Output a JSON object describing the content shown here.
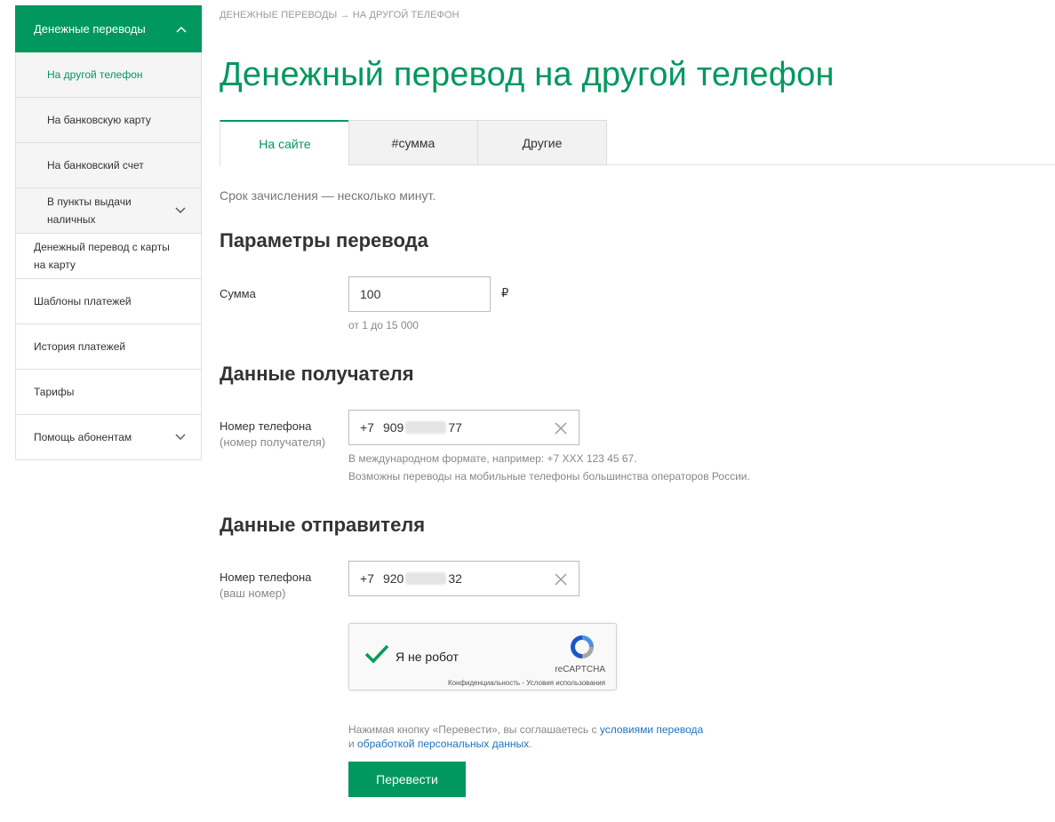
{
  "sidebar": {
    "header": {
      "label": "Денежные переводы",
      "icon": "chevron-up-icon"
    },
    "sub_items": [
      {
        "label": "На другой телефон",
        "active": true
      },
      {
        "label": "На банковскую карту"
      },
      {
        "label": "На банковский счет"
      },
      {
        "label": "В пункты выдачи наличных",
        "icon": "chevron-down-icon"
      }
    ],
    "items": [
      {
        "label": "Денежный перевод с карты на карту"
      },
      {
        "label": "Шаблоны платежей"
      },
      {
        "label": "История платежей"
      },
      {
        "label": "Тарифы"
      },
      {
        "label": "Помощь абонентам",
        "icon": "chevron-down-icon"
      }
    ]
  },
  "breadcrumb": "ДЕНЕЖНЫЕ ПЕРЕВОДЫ → НА ДРУГОЙ ТЕЛЕФОН",
  "page_title": "Денежный перевод на другой телефон",
  "tabs": [
    {
      "label": "На сайте",
      "active": true
    },
    {
      "label": "#сумма"
    },
    {
      "label": "Другие"
    }
  ],
  "term_text": "Срок зачисления — несколько минут.",
  "params": {
    "title": "Параметры перевода",
    "amount_label": "Сумма",
    "amount_value": "100",
    "currency": "₽",
    "amount_hint": "от 1 до 15 000"
  },
  "recipient": {
    "title": "Данные получателя",
    "label": "Номер телефона",
    "sublabel": "(номер получателя)",
    "prefix": "+7",
    "code": "909",
    "suffix": "77",
    "hint1": "В международном формате, например: +7 XXX 123 45 67.",
    "hint2": "Возможны переводы на мобильные телефоны большинства операторов России."
  },
  "sender": {
    "title": "Данные отправителя",
    "label": "Номер телефона",
    "sublabel": "(ваш номер)",
    "prefix": "+7",
    "code": "920",
    "suffix": "32"
  },
  "captcha": {
    "label": "Я не робот",
    "brand": "reCAPTCHA",
    "terms": "Конфиденциальность - Условия использования"
  },
  "agree": {
    "text": "Нажимая кнопку «Перевести», вы соглашаетесь с",
    "link1": "условиями перевода",
    "and": "и",
    "link2": "обработкой персональных данных",
    "end": "."
  },
  "submit_label": "Перевести",
  "colors": {
    "accent": "#00985f",
    "link": "#1e73be"
  }
}
